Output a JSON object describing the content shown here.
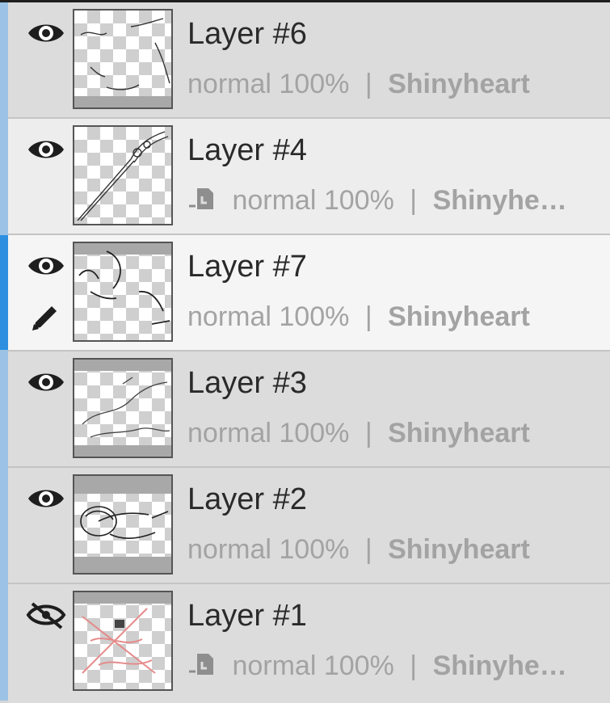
{
  "layers": [
    {
      "name": "Layer #6",
      "blend": "normal",
      "opacity": "100%",
      "sep": "|",
      "owner": "Shinyheart",
      "visible": true,
      "clipped": false,
      "editing": false
    },
    {
      "name": "Layer #4",
      "blend": "normal",
      "opacity": "100%",
      "sep": "|",
      "owner": "Shinyhe…",
      "visible": true,
      "clipped": true,
      "editing": false
    },
    {
      "name": "Layer #7",
      "blend": "normal",
      "opacity": "100%",
      "sep": "|",
      "owner": "Shinyheart",
      "visible": true,
      "clipped": false,
      "editing": true
    },
    {
      "name": "Layer #3",
      "blend": "normal",
      "opacity": "100%",
      "sep": "|",
      "owner": "Shinyheart",
      "visible": true,
      "clipped": false,
      "editing": false
    },
    {
      "name": "Layer #2",
      "blend": "normal",
      "opacity": "100%",
      "sep": "|",
      "owner": "Shinyheart",
      "visible": true,
      "clipped": false,
      "editing": false
    },
    {
      "name": "Layer #1",
      "blend": "normal",
      "opacity": "100%",
      "sep": "|",
      "owner": "Shinyhe…",
      "visible": false,
      "clipped": true,
      "editing": false
    }
  ],
  "icons": {
    "visibility": "eye-icon",
    "hidden": "eye-slash-icon",
    "editing": "pencil-icon",
    "clipping": "clipping-mask-icon"
  },
  "colors": {
    "active_accent": "#2e8fe0",
    "panel_accent": "#9cc3e6"
  }
}
